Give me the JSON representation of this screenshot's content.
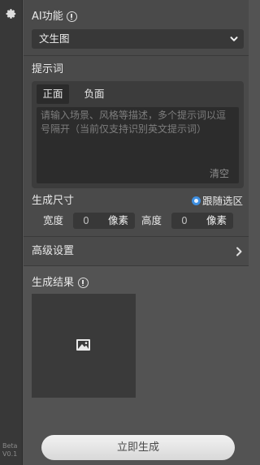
{
  "sidebar": {
    "icon": "gear-icon",
    "version_line1": "Beta",
    "version_line2": "V0.1"
  },
  "ai_function": {
    "label": "AI功能",
    "selected": "文生图"
  },
  "prompt": {
    "label": "提示词",
    "tabs": [
      "正面",
      "负面"
    ],
    "active_tab": "正面",
    "placeholder": "请输入场景、风格等描述，多个提示词以逗号隔开（当前仅支持识别英文提示词）",
    "value": "",
    "clear_label": "清空"
  },
  "size": {
    "label": "生成尺寸",
    "follow_selection_label": "跟随选区",
    "follow_selection_checked": true,
    "width_label": "宽度",
    "width_value": "0",
    "height_label": "高度",
    "height_value": "0",
    "unit": "像素"
  },
  "advanced": {
    "label": "高级设置"
  },
  "result": {
    "label": "生成结果",
    "placeholder_icon": "image-icon"
  },
  "actions": {
    "generate_label": "立即生成"
  },
  "colors": {
    "panel_bg": "#535353",
    "input_bg": "#383838",
    "accent_radio": "#3d8ee0"
  }
}
